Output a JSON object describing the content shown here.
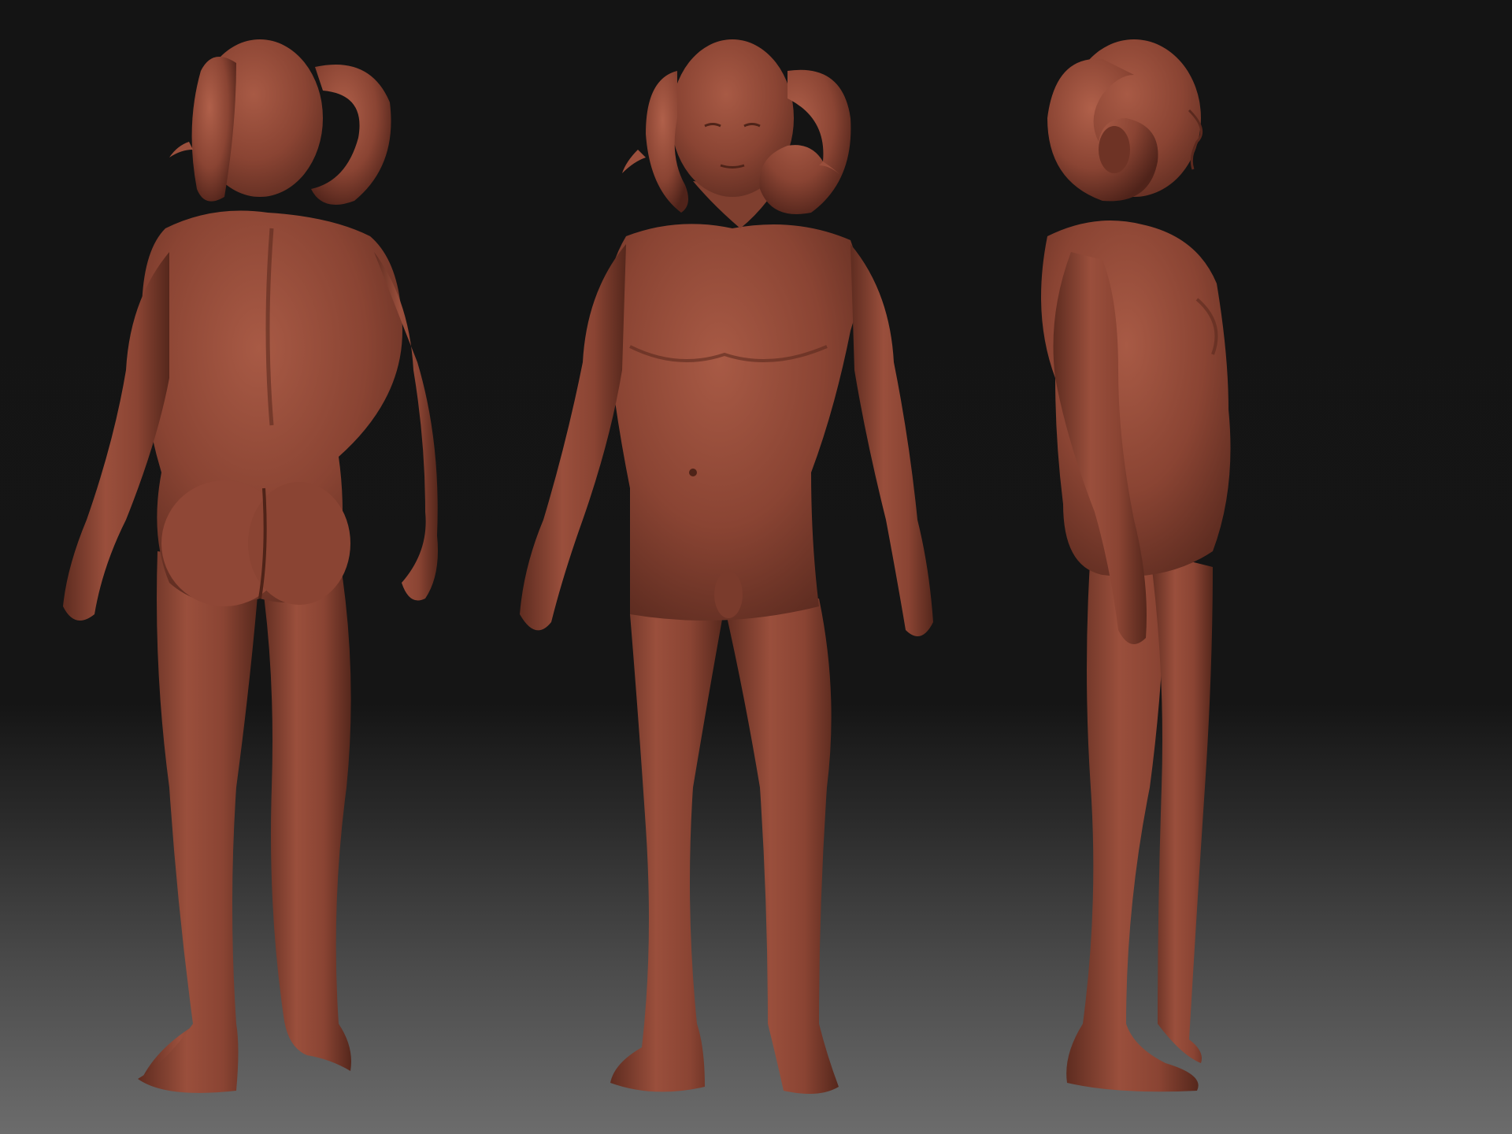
{
  "viewport": {
    "background_top": "#141414",
    "background_bottom": "#6c6c6c",
    "material_color": "#8a4433"
  },
  "views": [
    {
      "name": "back",
      "icon": "figure-back-view"
    },
    {
      "name": "front",
      "icon": "figure-front-view"
    },
    {
      "name": "side",
      "icon": "figure-side-view"
    }
  ]
}
